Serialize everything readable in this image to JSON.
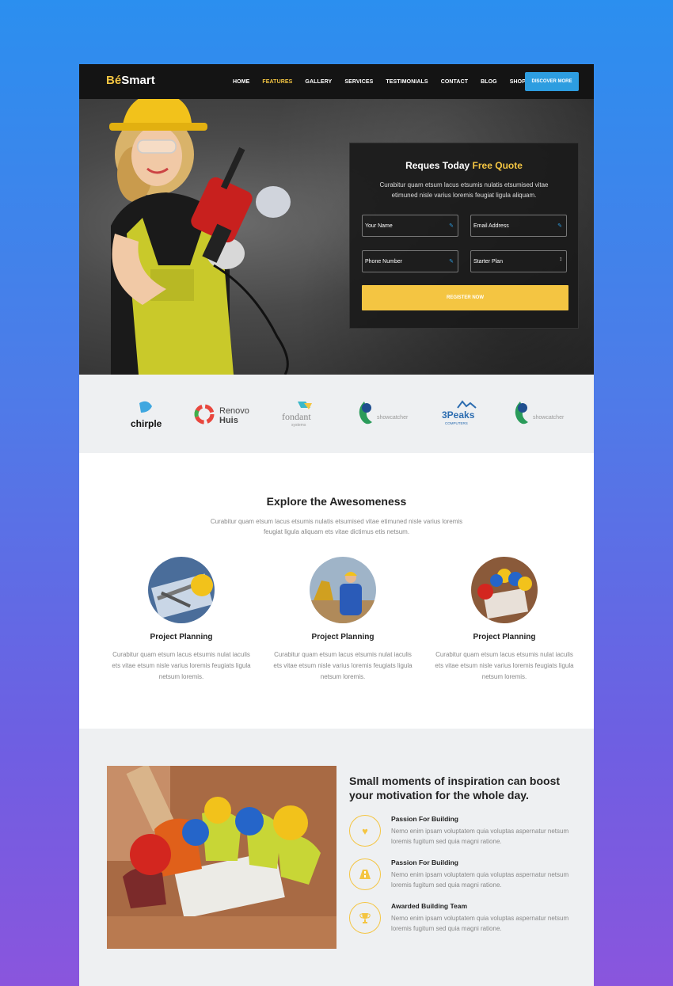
{
  "brand": {
    "logo_prefix": "Bé",
    "logo_suffix": "Smart",
    "accent": "#f4c542",
    "blue": "#2d9de0"
  },
  "nav": {
    "items": [
      {
        "label": "HOME",
        "active": false
      },
      {
        "label": "FEATURES",
        "active": true
      },
      {
        "label": "GALLERY",
        "active": false
      },
      {
        "label": "SERVICES",
        "active": false
      },
      {
        "label": "TESTIMONIALS",
        "active": false
      },
      {
        "label": "CONTACT",
        "active": false
      },
      {
        "label": "BLOG",
        "active": false
      },
      {
        "label": "SHOP",
        "active": false
      }
    ],
    "cta": "DISCOVER MORE"
  },
  "quote": {
    "title_main": "Reques Today ",
    "title_accent": "Free Quote",
    "description": "Curabitur quam etsum lacus etsumis nulatis etsumised vitae etimuned nisle varius loremis feugiat ligula aliquam.",
    "name_placeholder": "Your Name",
    "email_placeholder": "Email Address",
    "phone_placeholder": "Phone Number",
    "plan_selected": "Starter Plan",
    "register_label": "REGISTER NOW"
  },
  "logos": [
    "chirple",
    "Renovo Huis",
    "fondant systems",
    "showcatcher",
    "3Peaks computers",
    "showcatcher"
  ],
  "features": {
    "title": "Explore the Awesomeness",
    "description": "Curabitur quam etsum lacus etsumis nulatis etsumised vitae etimuned nisle varius loremis feugiat ligula aliquam ets vitae dictimus etis netsum.",
    "cards": [
      {
        "title": "Project Planning",
        "text": "Curabitur quam etsum lacus etsumis nulat iaculis ets vitae etsum nisle varius loremis feugiats ligula netsum loremis."
      },
      {
        "title": "Project Planning",
        "text": "Curabitur quam etsum lacus etsumis nulat iaculis ets vitae etsum nisle varius loremis feugiats ligula netsum loremis."
      },
      {
        "title": "Project Planning",
        "text": "Curabitur quam etsum lacus etsumis nulat iaculis ets vitae etsum nisle varius loremis feugiats ligula netsum loremis."
      }
    ]
  },
  "inspiration": {
    "title": "Small moments of inspiration can boost your motivation for the whole day.",
    "items": [
      {
        "icon": "heart-icon",
        "title": "Passion For Building",
        "text": "Nemo enim ipsam voluptatem quia voluptas aspernatur netsum loremis fugitum sed quia magni  ratione."
      },
      {
        "icon": "road-icon",
        "title": "Passion For Building",
        "text": "Nemo enim ipsam voluptatem quia voluptas aspernatur netsum loremis fugitum sed quia magni  ratione."
      },
      {
        "icon": "trophy-icon",
        "title": "Awarded Building Team",
        "text": "Nemo enim ipsam voluptatem quia voluptas aspernatur netsum loremis fugitum sed quia magni  ratione."
      }
    ]
  }
}
